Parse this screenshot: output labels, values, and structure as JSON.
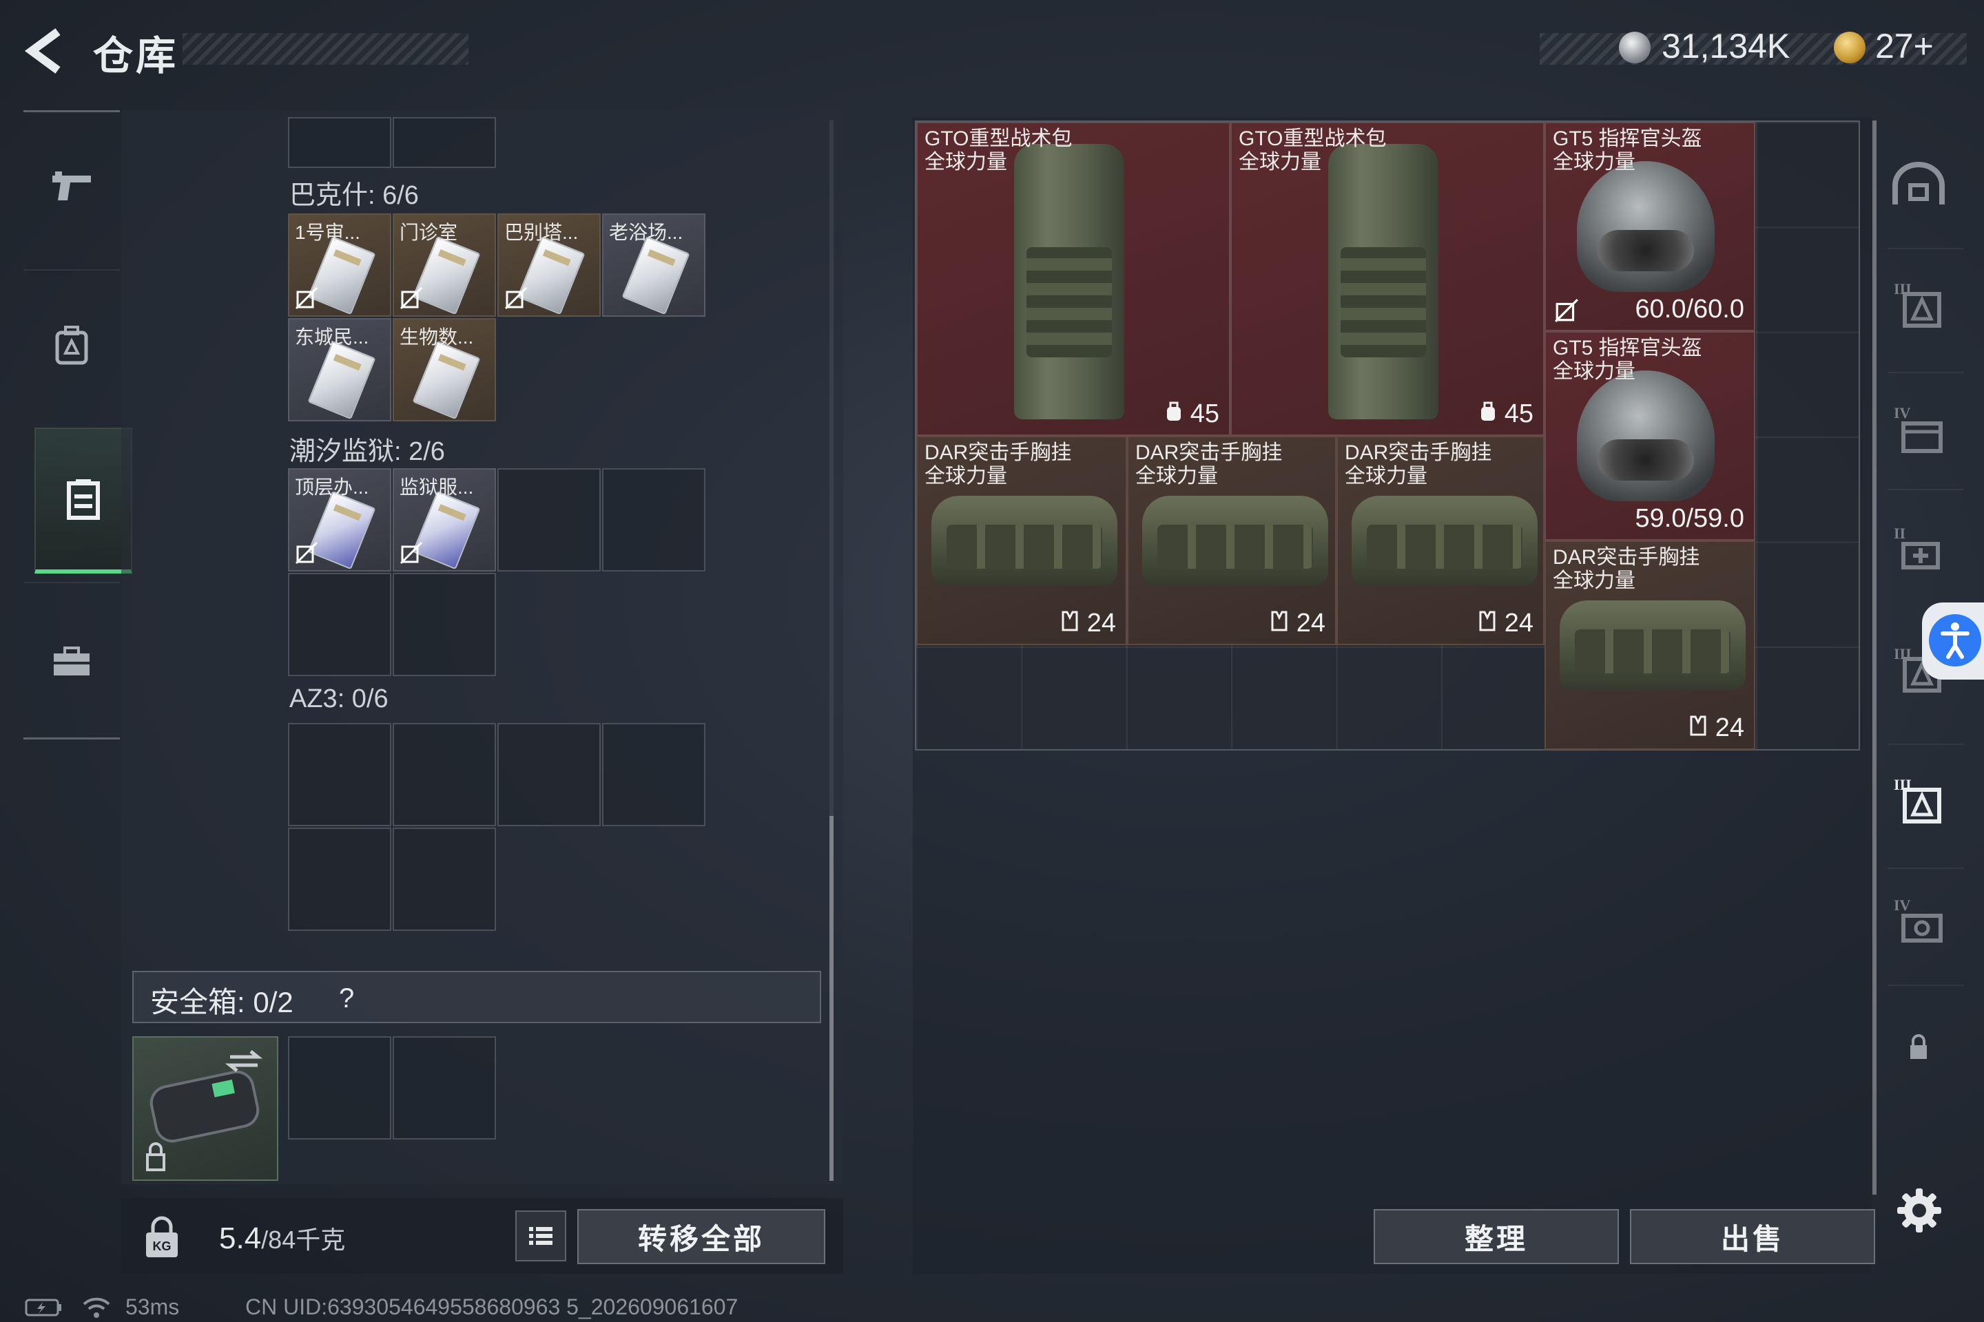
{
  "header": {
    "title": "仓库",
    "silver_amount": "31,134K",
    "gold_amount": "27+",
    "silver_icon": "silver-coin-icon",
    "gold_icon": "gold-coin-icon"
  },
  "left_nav": {
    "items": [
      {
        "name": "weapon",
        "icon": "gun-icon"
      },
      {
        "name": "backpack",
        "icon": "backpack-icon"
      },
      {
        "name": "vest",
        "icon": "vest-icon"
      },
      {
        "name": "case",
        "icon": "briefcase-icon"
      }
    ],
    "active_index": 2
  },
  "sections": {
    "bakesh": {
      "label": "巴克什: 6/6",
      "items": [
        "1号审...",
        "门诊室",
        "巴别塔...",
        "老浴场...",
        "东城民...",
        "生物数..."
      ]
    },
    "tide_prison": {
      "label": "潮汐监狱: 2/6",
      "items": [
        "顶层办...",
        "监狱服..."
      ]
    },
    "az3": {
      "label": "AZ3: 0/6"
    }
  },
  "safe_box": {
    "label": "安全箱: 0/2",
    "help": "?"
  },
  "bottom_left": {
    "weight_current": "5.4",
    "weight_max": "/84千克",
    "transfer_all": "转移全部"
  },
  "right_items": [
    {
      "name_line1": "GTO重型战术包",
      "name_line2": "全球力量",
      "stat": "45"
    },
    {
      "name_line1": "GTO重型战术包",
      "name_line2": "全球力量",
      "stat": "45"
    },
    {
      "name_line1": "GT5 指挥官头盔",
      "name_line2": "全球力量",
      "stat": "60.0/60.0"
    },
    {
      "name_line1": "GT5 指挥官头盔",
      "name_line2": "全球力量",
      "stat": "59.0/59.0"
    },
    {
      "name_line1": "DAR突击手胸挂",
      "name_line2": "全球力量",
      "stat": "24"
    },
    {
      "name_line1": "DAR突击手胸挂",
      "name_line2": "全球力量",
      "stat": "24"
    },
    {
      "name_line1": "DAR突击手胸挂",
      "name_line2": "全球力量",
      "stat": "24"
    },
    {
      "name_line1": "DAR突击手胸挂",
      "name_line2": "全球力量",
      "stat": "24"
    }
  ],
  "right_buttons": {
    "sort": "整理",
    "sell": "出售"
  },
  "right_nav": {
    "items": [
      "helmet-slot-icon",
      "armor-lv3-icon",
      "backpack-lv4-icon",
      "medkit-lv2-icon",
      "armor-lv3-alt-icon",
      "armor-lv3-active-icon",
      "gear-lv4-icon",
      "lock-icon"
    ],
    "tier_labels": [
      "III",
      "IV",
      "II",
      "III",
      "III",
      "IV"
    ]
  },
  "status": {
    "ping": "53ms",
    "uid": "CN UID:6393054649558680963 5_202609061607"
  }
}
